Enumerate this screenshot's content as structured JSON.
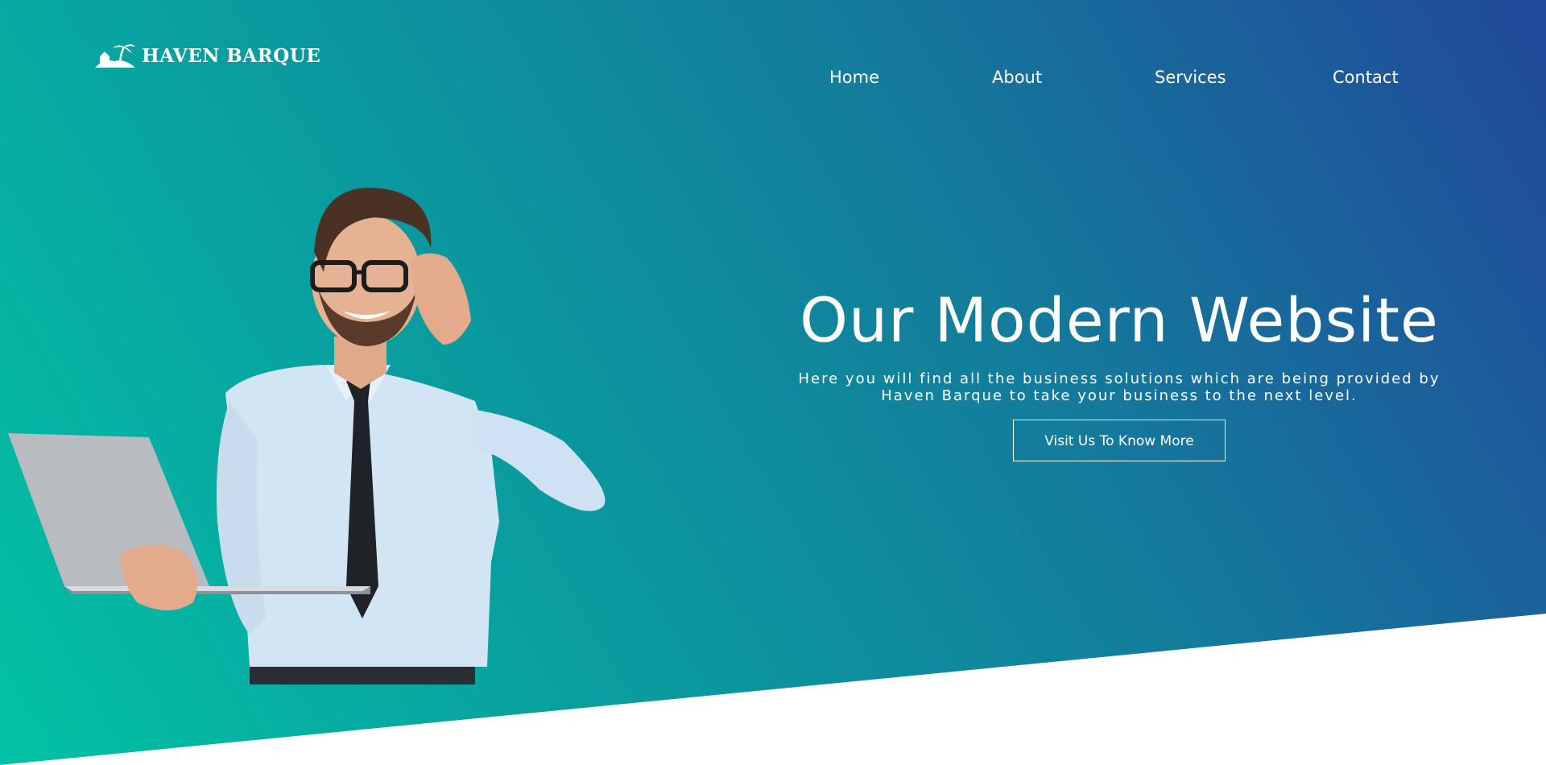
{
  "brand": {
    "name": "HAVEN BARQUE",
    "logo_icon": "island-palm-icon"
  },
  "nav": {
    "items": [
      "Home",
      "About",
      "Services",
      "Contact"
    ]
  },
  "hero": {
    "headline": "Our Modern Website",
    "subtext": "Here you will find all the business solutions which are being provided by Haven Barque to take your business to the next level.",
    "cta_label": "Visit Us To Know More",
    "image": "businessman-with-laptop"
  },
  "colors": {
    "gradient_start": "#02c2a4",
    "gradient_end": "#21489a",
    "text": "#ffffff"
  }
}
